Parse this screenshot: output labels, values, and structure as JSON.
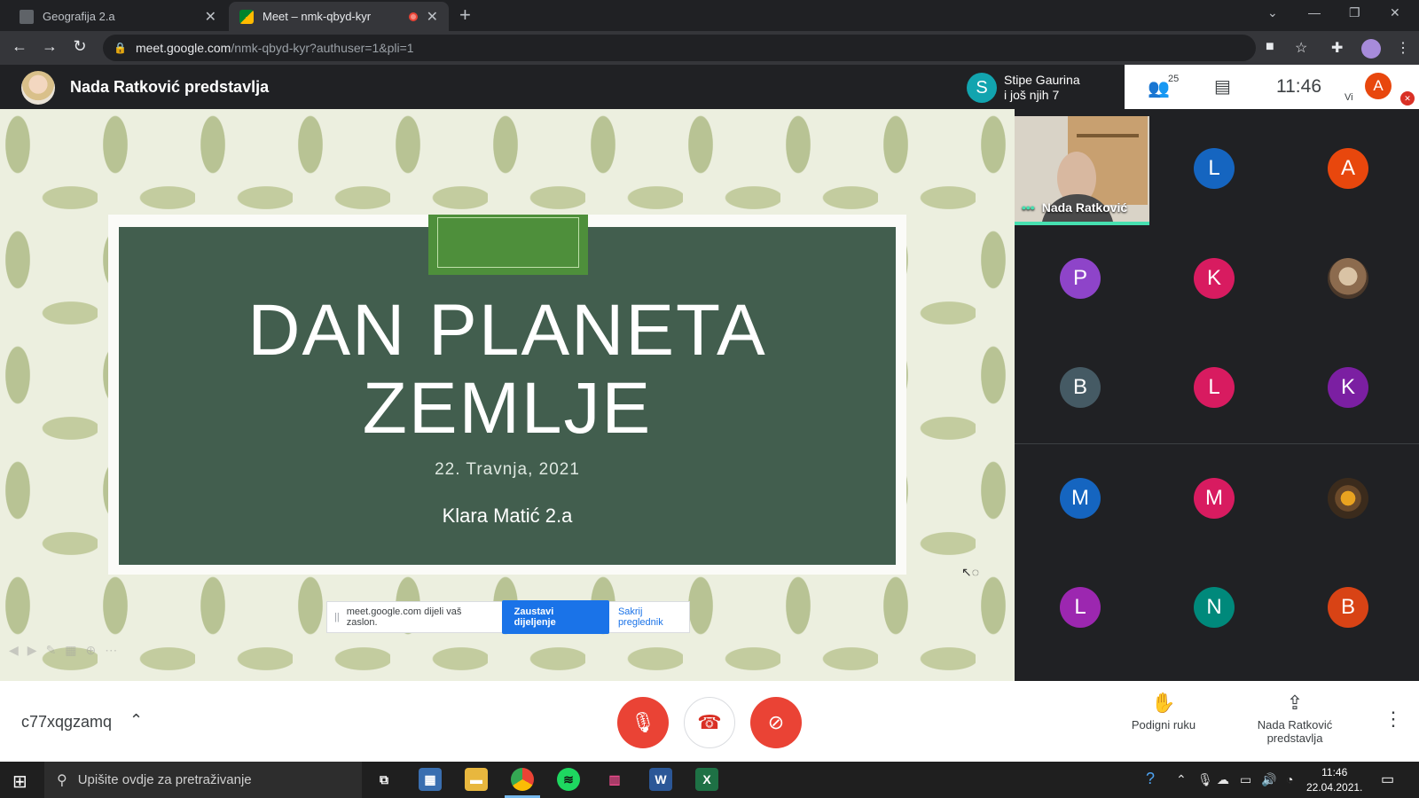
{
  "browser": {
    "tabs": [
      {
        "title": "Geografija 2.a",
        "icon": "classroom-icon"
      },
      {
        "title": "Meet – nmk-qbyd-kyr",
        "icon": "meet-icon",
        "recording": true
      }
    ],
    "url_host": "meet.google.com",
    "url_path": "/nmk-qbyd-kyr?authuser=1&pli=1"
  },
  "meet": {
    "presenter_title": "Nada Ratković predstavlja",
    "active_speaker": {
      "initial": "S",
      "line1": "Stipe Gaurina",
      "line2": "i još njih 7"
    },
    "participants_count": "25",
    "clock": "11:46",
    "self_label": "Vi",
    "self_initial": "A"
  },
  "slide": {
    "title_line1": "DAN PLANETA",
    "title_line2": "ZEMLJE",
    "date": "22. Travnja, 2021",
    "author": "Klara Matić 2.a"
  },
  "share_banner": {
    "text": "meet.google.com dijeli vaš zaslon.",
    "stop": "Zaustavi dijeljenje",
    "hide": "Sakrij preglednik"
  },
  "grid": {
    "video_tile_name": "Nada Ratković",
    "tiles": [
      {
        "initial": "L",
        "color": "#1565c0"
      },
      {
        "initial": "A",
        "color": "#e8470d"
      },
      {
        "initial": "P",
        "color": "#8e44c9"
      },
      {
        "initial": "K",
        "color": "#d81b60"
      },
      {
        "initial": "",
        "color": "photo2"
      },
      {
        "initial": "B",
        "color": "#455a64"
      },
      {
        "initial": "L",
        "color": "#d81b60"
      },
      {
        "initial": "K",
        "color": "#7b1fa2"
      },
      {
        "initial": "M",
        "color": "#1565c0"
      },
      {
        "initial": "M",
        "color": "#d81b60"
      },
      {
        "initial": "",
        "color": "photo"
      },
      {
        "initial": "L",
        "color": "#9c27b0"
      },
      {
        "initial": "N",
        "color": "#00897b"
      },
      {
        "initial": "B",
        "color": "#d84315"
      }
    ]
  },
  "bottom": {
    "meeting_code": "c77xqgzamq",
    "raise_hand": "Podigni ruku",
    "presenting_line1": "Nada Ratković",
    "presenting_line2": "predstavlja"
  },
  "taskbar": {
    "search_placeholder": "Upišite ovdje za pretraživanje",
    "time": "11:46",
    "date": "22.04.2021."
  }
}
